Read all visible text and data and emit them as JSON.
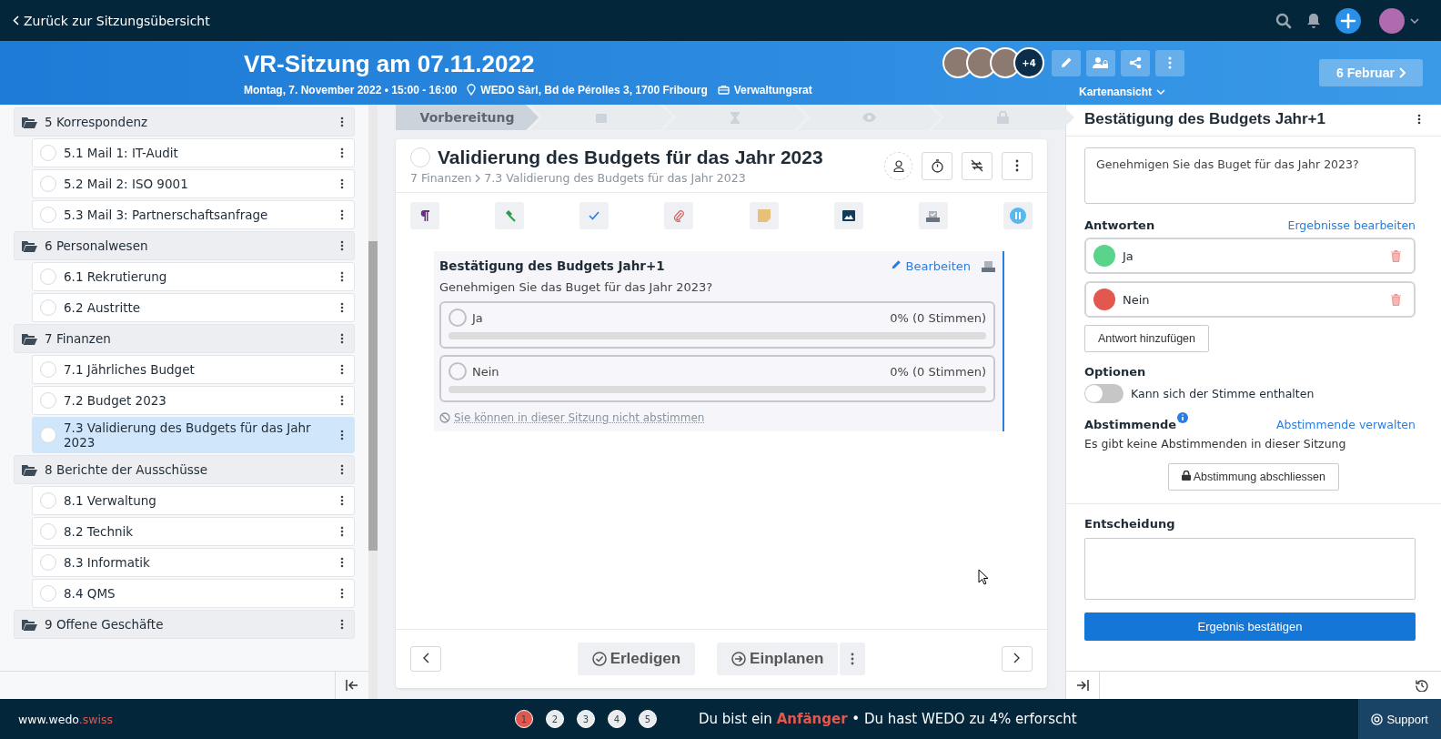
{
  "topbar": {
    "back_link": "Zurück zur Sitzungsübersicht"
  },
  "header": {
    "title": "VR-Sitzung am 07.11.2022",
    "date": "Montag, 7. November 2022 • 15:00 - 16:00",
    "location": "WEDO Sàrl, Bd de Pérolles 3, 1700 Fribourg",
    "group": "Verwaltungsrat",
    "more_participants": "+4",
    "view_selector": "Kartenansicht",
    "next_meeting": "6 Februar"
  },
  "sidebar": {
    "items": [
      {
        "label": "5 Korrespondenz",
        "selected": false,
        "children": [
          {
            "label": "5.1 Mail 1: IT-Audit",
            "selected": false
          },
          {
            "label": "5.2 Mail 2: ISO 9001",
            "selected": false
          },
          {
            "label": "5.3 Mail 3: Partnerschaftsanfrage",
            "selected": false
          }
        ]
      },
      {
        "label": "6 Personalwesen",
        "selected": false,
        "children": [
          {
            "label": "6.1 Rekrutierung",
            "selected": false
          },
          {
            "label": "6.2 Austritte",
            "selected": false
          }
        ]
      },
      {
        "label": "7 Finanzen",
        "selected": false,
        "children": [
          {
            "label": "7.1 Jährliches Budget",
            "selected": false
          },
          {
            "label": "7.2 Budget 2023",
            "selected": false
          },
          {
            "label": "7.3 Validierung des Budgets für das Jahr 2023",
            "selected": true
          }
        ]
      },
      {
        "label": "8 Berichte der Ausschüsse",
        "selected": false,
        "children": [
          {
            "label": "8.1 Verwaltung",
            "selected": false
          },
          {
            "label": "8.2 Technik",
            "selected": false
          },
          {
            "label": "8.3 Informatik",
            "selected": false
          },
          {
            "label": "8.4 QMS",
            "selected": false
          }
        ]
      },
      {
        "label": "9 Offene Geschäfte",
        "selected": false
      }
    ]
  },
  "stepper": [
    {
      "kind": "label",
      "label": "Vorbereitung",
      "selected": true
    },
    {
      "kind": "calendar",
      "selected": false
    },
    {
      "kind": "hourglass",
      "selected": false
    },
    {
      "kind": "eye",
      "selected": false
    },
    {
      "kind": "lock",
      "selected": false
    }
  ],
  "topic": {
    "title": "Validierung des Budgets für das Jahr 2023",
    "breadcrumb": [
      "7 Finanzen",
      "7.3 Validierung des Budgets für das Jahr 2023"
    ],
    "done": false
  },
  "poll": {
    "title": "Bestätigung des Budgets Jahr+1",
    "edit": "Bearbeiten",
    "question": "Genehmigen Sie das Buget für das Jahr 2023?",
    "answers": [
      {
        "label": "Ja",
        "reading": "0% (0 Stimmen)",
        "level": 0,
        "selected": false
      },
      {
        "label": "Nein",
        "reading": "0% (0 Stimmen)",
        "level": 0,
        "selected": false
      }
    ],
    "notice": "Sie können in dieser Sitzung nicht abstimmen"
  },
  "footer_actions": {
    "done": "Erledigen",
    "schedule": "Einplanen"
  },
  "panel": {
    "title": "Bestätigung des Budgets Jahr+1",
    "question": "Genehmigen Sie das Buget für das Jahr 2023?",
    "answers_heading": "Antworten",
    "edit_results": "Ergebnisse bearbeiten",
    "answers": [
      {
        "label": "Ja",
        "color": "#5ad48a"
      },
      {
        "label": "Nein",
        "color": "#e2584f"
      }
    ],
    "add_answer": "Antwort hinzufügen",
    "options_heading": "Optionen",
    "abstain": {
      "label": "Kann sich der Stimme enthalten",
      "on": false
    },
    "voters_heading": "Abstimmende",
    "manage_voters": "Abstimmende verwalten",
    "voters_note": "Es gibt keine Abstimmenden in dieser Sitzung",
    "close_vote": "Abstimmung abschliessen",
    "decision_heading": "Entscheidung",
    "confirm": "Ergebnis bestätigen"
  },
  "statusbar": {
    "site": "www.wedo",
    "site_suffix": ".swiss",
    "levels": [
      {
        "label": "1",
        "selected": true
      },
      {
        "label": "2",
        "selected": false
      },
      {
        "label": "3",
        "selected": false
      },
      {
        "label": "4",
        "selected": false
      },
      {
        "label": "5",
        "selected": false
      }
    ],
    "progress": "Du bist ein **Anfänger** • Du hast WEDO zu 4% erforscht",
    "support": "Support"
  }
}
